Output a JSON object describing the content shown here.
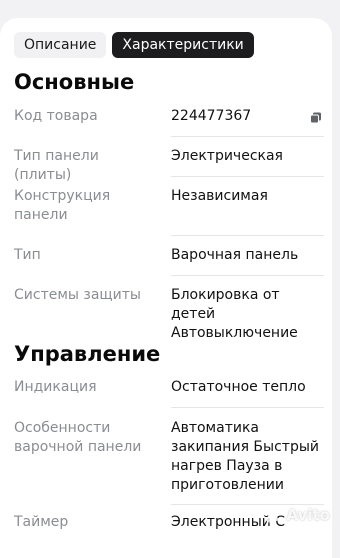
{
  "tabs": [
    {
      "label": "Описание",
      "active": false
    },
    {
      "label": "Характеристики",
      "active": true
    }
  ],
  "sections": [
    {
      "title": "Основные",
      "rows": [
        {
          "label": "Код товара",
          "value": "224477367",
          "copy_icon": "copy-icon"
        },
        {
          "label": "Тип панели (плиты)",
          "value": "Электрическая"
        },
        {
          "label": "Конструкция панели",
          "value": "Независимая"
        },
        {
          "label": "Тип",
          "value": "Варочная панель"
        },
        {
          "label": "Системы защиты",
          "value": "Блокировка от детей Автовыключение"
        }
      ]
    },
    {
      "title": "Управление",
      "rows": [
        {
          "label": "Индикация",
          "value": "Остаточное тепло"
        },
        {
          "label": "Особенности варочной панели",
          "value": "Автоматика закипания Быстрый нагрев Пауза в приготовлении"
        },
        {
          "label": "Таймер",
          "value": "Электронный С"
        }
      ]
    }
  ],
  "watermark": {
    "text": "Avito",
    "icon": "avito-logo-icon"
  }
}
